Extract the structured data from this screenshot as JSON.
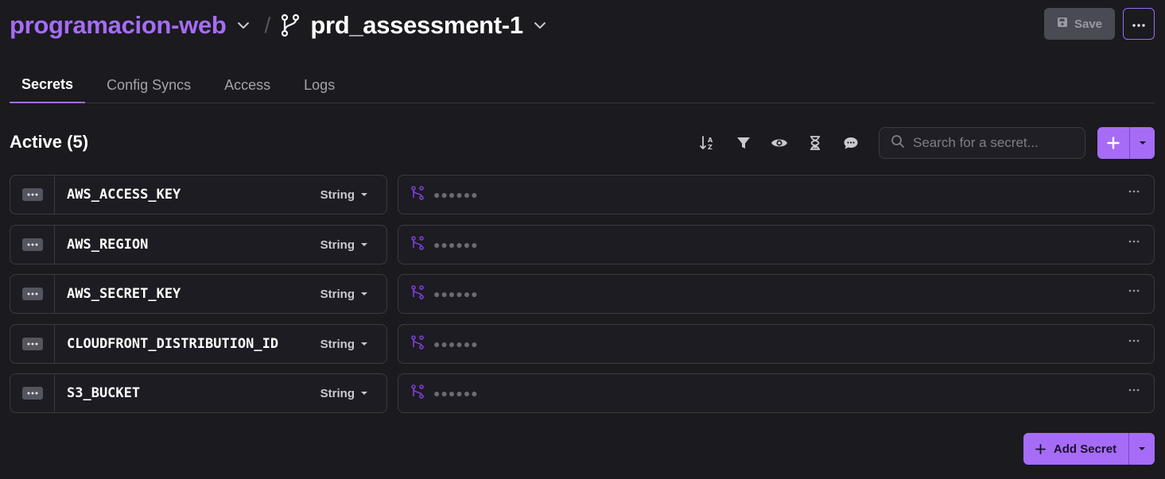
{
  "header": {
    "project_name": "programacion-web",
    "separator": "/",
    "environment_name": "prd_assessment-1",
    "save_label": "Save"
  },
  "tabs": [
    {
      "label": "Secrets",
      "active": true
    },
    {
      "label": "Config Syncs",
      "active": false
    },
    {
      "label": "Access",
      "active": false
    },
    {
      "label": "Logs",
      "active": false
    }
  ],
  "section": {
    "title": "Active (5)"
  },
  "toolbar": {
    "icons": [
      "sort-az-icon",
      "filter-icon",
      "eye-icon",
      "hourglass-icon",
      "comment-icon"
    ],
    "search_placeholder": "Search for a secret..."
  },
  "secrets": [
    {
      "key": "AWS_ACCESS_KEY",
      "type": "String",
      "masked_value": "●●●●●●"
    },
    {
      "key": "AWS_REGION",
      "type": "String",
      "masked_value": "●●●●●●"
    },
    {
      "key": "AWS_SECRET_KEY",
      "type": "String",
      "masked_value": "●●●●●●"
    },
    {
      "key": "CLOUDFRONT_DISTRIBUTION_ID",
      "type": "String",
      "masked_value": "●●●●●●"
    },
    {
      "key": "S3_BUCKET",
      "type": "String",
      "masked_value": "●●●●●●"
    }
  ],
  "footer": {
    "add_secret_label": "Add Secret"
  },
  "colors": {
    "accent": "#a66cf5",
    "background": "#1a1a1f",
    "border": "#3a3a42"
  }
}
